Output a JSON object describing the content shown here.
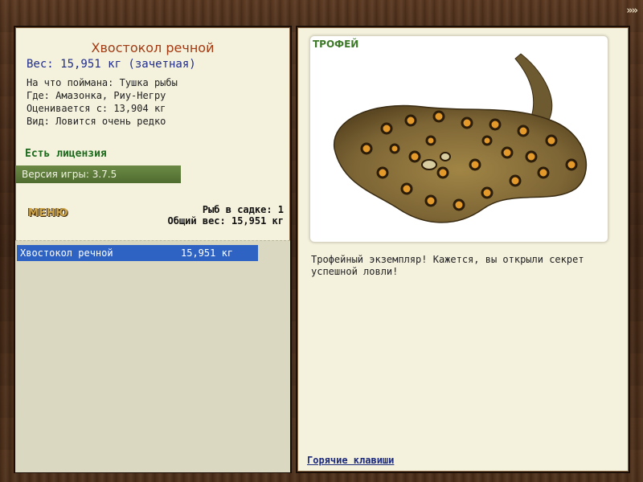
{
  "nav": {
    "forward_icon": "»»"
  },
  "fish": {
    "title": "Хвостокол речной",
    "weight_line": "Вес: 15,951 кг (зачетная)",
    "bait": "На что поймана: Тушка рыбы",
    "location": "Где: Амазонка, Риу-Негру",
    "valued_from": "Оценивается с: 13,904 кг",
    "rarity": "Вид: Ловится очень редко"
  },
  "license": "Есть лицензия",
  "version": "Версия игры: 3.7.5",
  "menu_label": "МЕНЮ",
  "keepnet": {
    "fish_count": "Рыб в садке: 1",
    "total_weight": "Общий вес: 15,951 кг",
    "rows": [
      {
        "name": "Хвостокол речной",
        "weight": "15,951 кг"
      }
    ]
  },
  "trophy": {
    "label": "ТРОФЕЙ",
    "description": "Трофейный экземпляр! Кажется, вы открыли секрет успешной ловли!"
  },
  "hotkeys_label": "Горячие клавиши"
}
